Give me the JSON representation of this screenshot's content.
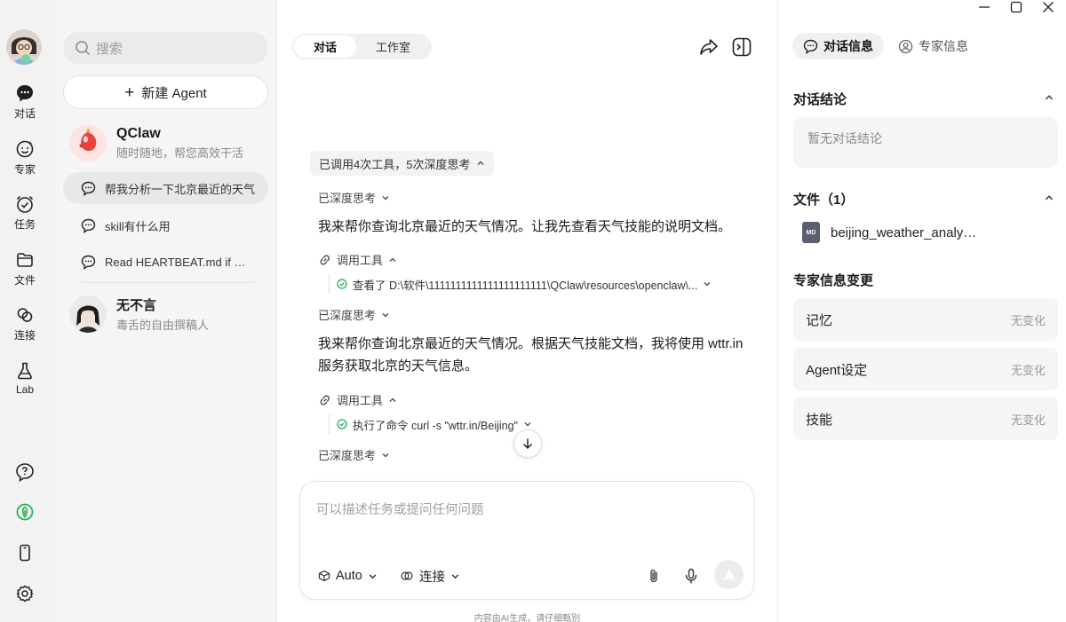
{
  "rail": {
    "items": [
      {
        "label": "对话",
        "icon": "chat-icon"
      },
      {
        "label": "专家",
        "icon": "expert-icon"
      },
      {
        "label": "任务",
        "icon": "task-icon"
      },
      {
        "label": "文件",
        "icon": "folder-icon"
      },
      {
        "label": "连接",
        "icon": "link-icon"
      },
      {
        "label": "Lab",
        "icon": "flask-icon"
      }
    ],
    "bottom_icons": [
      "help-icon",
      "claw-icon",
      "phone-icon",
      "settings-icon"
    ]
  },
  "sessions": {
    "search_placeholder": "搜索",
    "new_agent": "新建 Agent",
    "agents": [
      {
        "name": "QClaw",
        "subtitle": "随时随地，帮您高效干活"
      },
      {
        "name": "无不言",
        "subtitle": "毒舌的自由撰稿人"
      }
    ],
    "chats": [
      {
        "title": "帮我分析一下北京最近的天气",
        "active": true
      },
      {
        "title": "skill有什么用",
        "active": false
      },
      {
        "title": "Read HEARTBEAT.md if it exists",
        "active": false
      }
    ]
  },
  "main": {
    "tabs": [
      {
        "label": "对话",
        "active": true
      },
      {
        "label": "工作室",
        "active": false
      }
    ],
    "summary_pill": "已调用4次工具，5次深度思考",
    "think_label": "已深度思考",
    "message_1": "我来帮你查询北京最近的天气情况。让我先查看天气技能的说明文档。",
    "tool_label": "调用工具",
    "tool_1": "查看了 D:\\软件\\1111111111111111111111\\QClaw\\resources\\openclaw\\...",
    "message_2": "我来帮你查询北京最近的天气情况。根据天气技能文档，我将使用 wttr.in 服务获取北京的天气信息。",
    "tool_2": "执行了命令 curl -s \"wttr.in/Beijing\"",
    "composer_placeholder": "可以描述任务或提问任何问题",
    "mode_label": "Auto",
    "connect_label": "连接",
    "disclaimer": "内容由AI生成，请仔细甄别"
  },
  "right": {
    "tabs": [
      {
        "label": "对话信息",
        "active": true
      },
      {
        "label": "专家信息",
        "active": false
      }
    ],
    "summary_title": "对话结论",
    "summary_empty": "暂无对话结论",
    "files_title": "文件（1）",
    "file_type": "MD",
    "file_name": "beijing_weather_analysis.md",
    "changes_title": "专家信息变更",
    "changes": [
      {
        "key": "记忆",
        "value": "无变化"
      },
      {
        "key": "Agent设定",
        "value": "无变化"
      },
      {
        "key": "技能",
        "value": "无变化"
      }
    ]
  },
  "colors": {
    "accent_green": "#2bb24c",
    "check_green": "#23a55a"
  }
}
